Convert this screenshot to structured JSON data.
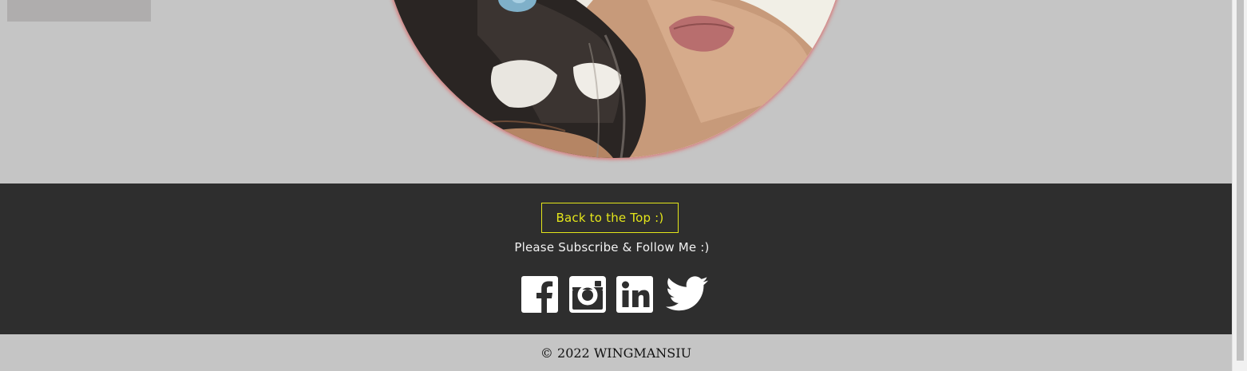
{
  "hero": {
    "photo_icon": "profile-photo-cat-and-person"
  },
  "footer": {
    "back_to_top_label": "Back to the Top :)",
    "subscribe_text": "Please Subscribe & Follow Me :)",
    "social_links": [
      {
        "name": "Facebook",
        "icon": "facebook-icon"
      },
      {
        "name": "Instagram",
        "icon": "instagram-icon"
      },
      {
        "name": "LinkedIn",
        "icon": "linkedin-icon"
      },
      {
        "name": "Twitter",
        "icon": "twitter-icon"
      }
    ],
    "accent_color": "#e4e61a",
    "background_color": "#2e2e2e"
  },
  "copyright": {
    "text": "© 2022 WINGMANSIU"
  },
  "page": {
    "background_color": "#c5c5c5"
  }
}
